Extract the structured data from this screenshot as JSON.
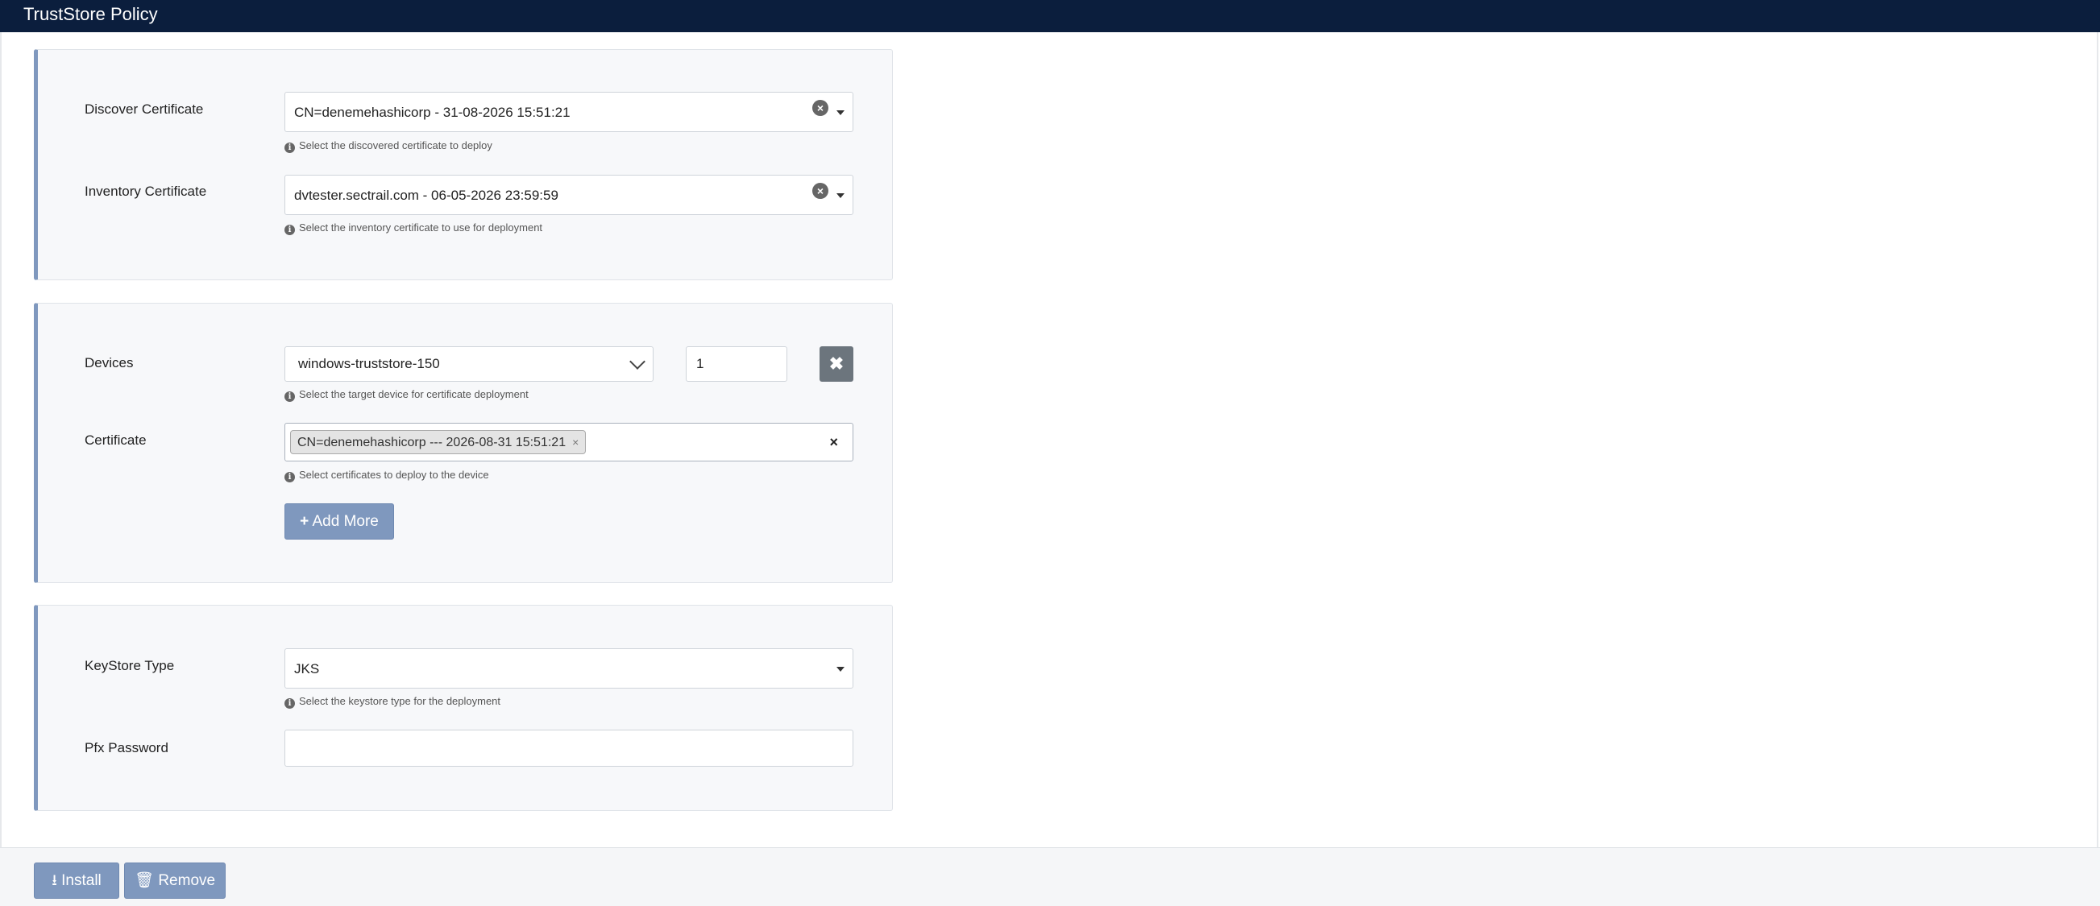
{
  "header": {
    "title": "TrustStore Policy"
  },
  "certificates_section": {
    "discover_label": "Discover Certificate",
    "discover_value": "CN=denemehashicorp - 31-08-2026 15:51:21",
    "discover_help": "Select the discovered certificate to deploy",
    "inventory_label": "Inventory Certificate",
    "inventory_value": "dvtester.sectrail.com - 06-05-2026 23:59:59",
    "inventory_help": "Select the inventory certificate to use for deployment"
  },
  "devices_section": {
    "devices_label": "Devices",
    "device_value": "windows-truststore-150",
    "quantity_value": "1",
    "remove_glyph": "✖",
    "devices_help": "Select the target device for certificate deployment",
    "certificate_label": "Certificate",
    "certificate_tag": "CN=denemehashicorp --- 2026-08-31 15:51:21",
    "tag_remove_glyph": "×",
    "clear_all_glyph": "×",
    "certificate_help": "Select certificates to deploy to the device",
    "add_more_label": "Add More"
  },
  "keystore_section": {
    "keystore_label": "KeyStore Type",
    "keystore_value": "JKS",
    "keystore_help": "Select the keystore type for the deployment",
    "pfx_label": "Pfx Password",
    "pfx_value": ""
  },
  "footer": {
    "install_label": "Install",
    "remove_label": "Remove"
  },
  "colors": {
    "topbar": "#0b1e3d",
    "accent": "#7f98be",
    "danger_gray": "#6c757d"
  },
  "icons": {
    "info": "info-circle-icon",
    "clear": "clear-circle-icon",
    "caret": "caret-down-icon",
    "plus": "plus-icon",
    "download": "download-icon",
    "trash": "trash-icon"
  }
}
